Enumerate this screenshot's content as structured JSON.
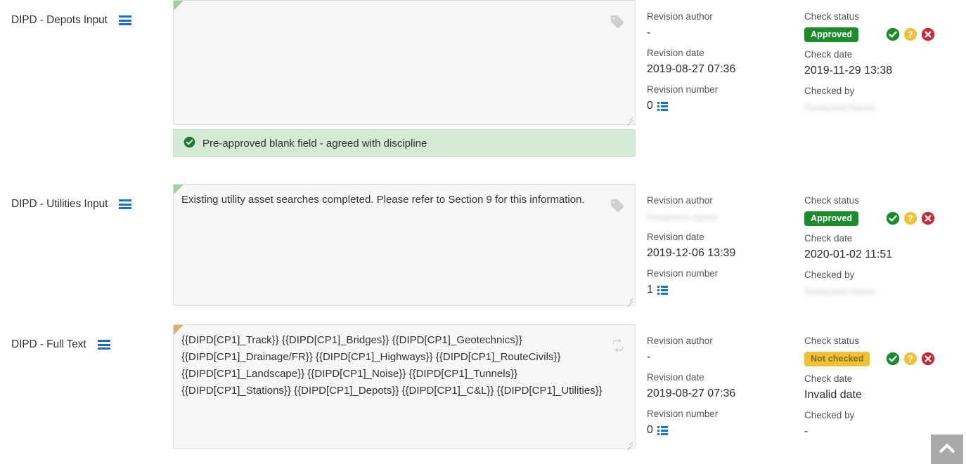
{
  "colors": {
    "approved_badge": "#1e8a2e",
    "not_checked_badge": "#eec13a",
    "accent_blue": "#1e6fb8",
    "success_banner_bg": "#d5ead5",
    "field_bg": "#f7f7f7",
    "scroll_top_bg": "#a9a9a9"
  },
  "meta_headings": {
    "revision_author": "Revision author",
    "revision_date": "Revision date",
    "revision_number": "Revision number",
    "check_status": "Check status",
    "check_date": "Check date",
    "checked_by": "Checked by"
  },
  "check_actions": {
    "approve": "approve-check",
    "query": "query-check",
    "reject": "reject-check"
  },
  "scroll_top": {
    "label": "Scroll to top"
  },
  "rows": [
    {
      "label": "DIPD - Depots Input",
      "menu_icon": "hamburger-icon",
      "corner_flag": "green",
      "field_text": "",
      "field_icon": "tag-icon",
      "banner": {
        "icon": "check-circle-icon",
        "text": "Pre-approved blank field - agreed with discipline"
      },
      "revision_author": "-",
      "revision_author_redacted": false,
      "revision_date": "2019-08-27 07:36",
      "revision_number": "0",
      "check_status": "Approved",
      "check_status_kind": "approved",
      "check_date": "2019-11-29 13:38",
      "checked_by": "Redacted Name",
      "checked_by_redacted": true
    },
    {
      "label": "DIPD - Utilities Input",
      "menu_icon": "hamburger-icon",
      "corner_flag": "green",
      "field_text": "Existing utility asset searches completed. Please refer to Section 9 for this information.",
      "field_icon": "tag-icon",
      "banner": null,
      "revision_author": "Redacted Name",
      "revision_author_redacted": true,
      "revision_date": "2019-12-06 13:39",
      "revision_number": "1",
      "check_status": "Approved",
      "check_status_kind": "approved",
      "check_date": "2020-01-02 11:51",
      "checked_by": "Redacted Name",
      "checked_by_redacted": true
    },
    {
      "label": "DIPD - Full Text",
      "menu_icon": "hamburger-icon",
      "corner_flag": "amber",
      "field_text": "{{DIPD[CP1]_Track}} {{DIPD[CP1]_Bridges}} {{DIPD[CP1]_Geotechnics}} {{DIPD[CP1]_Drainage/FR}} {{DIPD[CP1]_Highways}} {{DIPD[CP1]_RouteCivils}} {{DIPD[CP1]_Landscape}} {{DIPD[CP1]_Noise}} {{DIPD[CP1]_Tunnels}} {{DIPD[CP1]_Stations}} {{DIPD[CP1]_Depots}} {{DIPD[CP1]_C&L}} {{DIPD[CP1]_Utilities}}",
      "field_icon": "sync-icon",
      "banner": null,
      "revision_author": "-",
      "revision_author_redacted": false,
      "revision_date": "2019-08-27 07:36",
      "revision_number": "0",
      "check_status": "Not checked",
      "check_status_kind": "not-checked",
      "check_date": "Invalid date",
      "checked_by": "-",
      "checked_by_redacted": false
    }
  ]
}
